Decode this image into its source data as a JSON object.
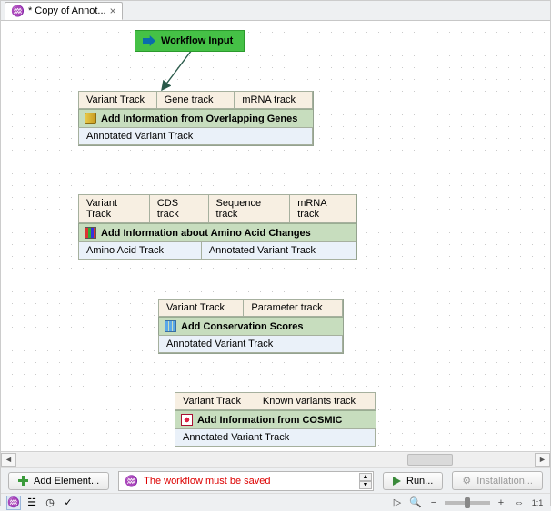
{
  "tab": {
    "title": "* Copy of Annot..."
  },
  "input_node": {
    "label": "Workflow Input"
  },
  "node1": {
    "inputs": [
      "Variant Track",
      "Gene track",
      "mRNA track"
    ],
    "title": "Add Information from Overlapping Genes",
    "outputs": [
      "Annotated Variant Track"
    ]
  },
  "node2": {
    "inputs": [
      "Variant Track",
      "CDS track",
      "Sequence track",
      "mRNA track"
    ],
    "title": "Add Information about Amino Acid Changes",
    "outputs": [
      "Amino Acid Track",
      "Annotated Variant Track"
    ]
  },
  "node3": {
    "inputs": [
      "Variant Track",
      "Parameter track"
    ],
    "title": "Add Conservation Scores",
    "outputs": [
      "Annotated Variant Track"
    ]
  },
  "node4": {
    "inputs": [
      "Variant Track",
      "Known variants track"
    ],
    "title": "Add Information from COSMIC",
    "outputs": [
      "Annotated Variant Track"
    ]
  },
  "bottom": {
    "add_element": "Add Element...",
    "message": "The workflow must be saved",
    "run": "Run...",
    "install": "Installation..."
  }
}
